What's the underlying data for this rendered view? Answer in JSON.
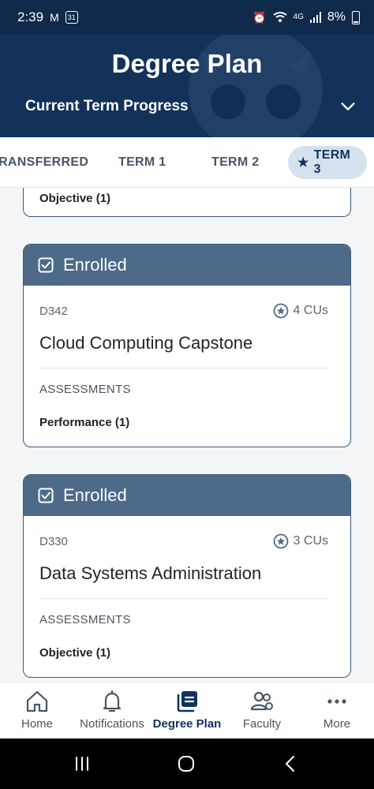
{
  "status_bar": {
    "time": "2:39",
    "battery": "8%"
  },
  "header": {
    "title": "Degree Plan",
    "progress_label": "Current Term Progress"
  },
  "tabs": [
    {
      "label": "TRANSFERRED",
      "active": false
    },
    {
      "label": "TERM 1",
      "active": false
    },
    {
      "label": "TERM 2",
      "active": false
    },
    {
      "label": "TERM 3",
      "active": true
    }
  ],
  "partial_card": {
    "assessment": "Objective (1)"
  },
  "courses": [
    {
      "status": "Enrolled",
      "code": "D342",
      "cus": "4 CUs",
      "title": "Cloud Computing Capstone",
      "assessments_label": "ASSESSMENTS",
      "assessment": "Performance (1)"
    },
    {
      "status": "Enrolled",
      "code": "D330",
      "cus": "3 CUs",
      "title": "Data Systems Administration",
      "assessments_label": "ASSESSMENTS",
      "assessment": "Objective (1)"
    }
  ],
  "bottom_nav": [
    {
      "label": "Home",
      "icon": "home-icon"
    },
    {
      "label": "Notifications",
      "icon": "bell-icon"
    },
    {
      "label": "Degree Plan",
      "icon": "degree-plan-icon",
      "active": true
    },
    {
      "label": "Faculty",
      "icon": "faculty-icon"
    },
    {
      "label": "More",
      "icon": "more-icon"
    }
  ],
  "colors": {
    "header": "#12325a",
    "card_header": "#4d6a89",
    "active_tab_bg": "#d5e2ee"
  }
}
